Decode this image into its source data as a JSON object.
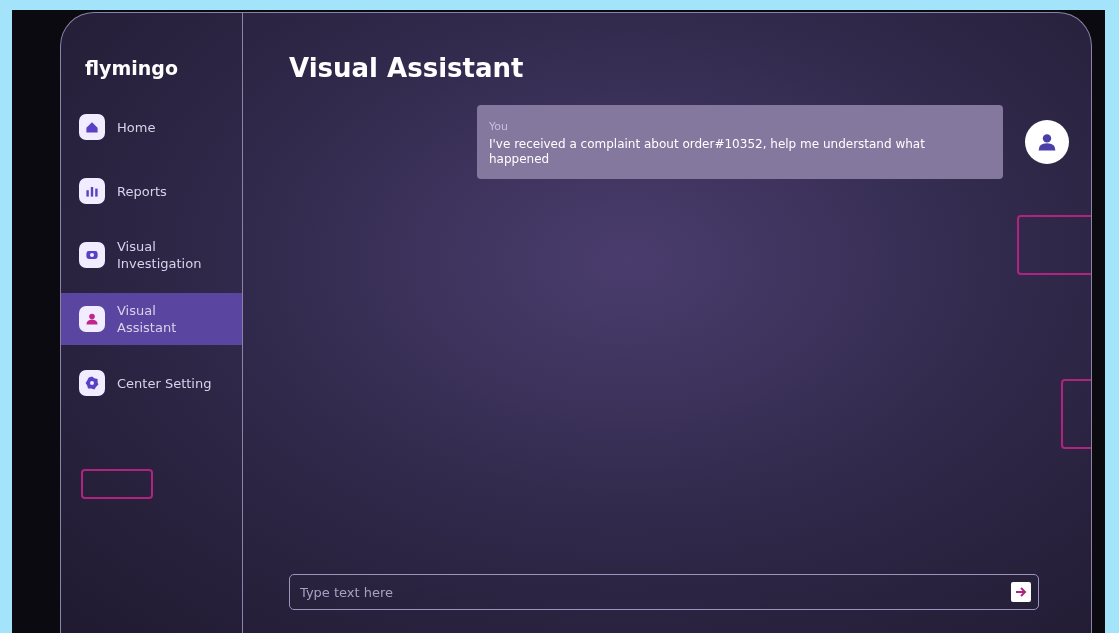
{
  "logo": "flymingo",
  "sidebar": {
    "items": [
      {
        "label": "Home",
        "selected": false
      },
      {
        "label": "Reports",
        "selected": false
      },
      {
        "label": "Visual Investigation",
        "selected": false
      },
      {
        "label": "Visual Assistant",
        "selected": true
      },
      {
        "label": "Center Setting",
        "selected": false
      }
    ]
  },
  "title": "Visual Assistant",
  "messages": [
    {
      "sender": "You",
      "text": "I've received a complaint about order#10352, help me understand what happened"
    }
  ],
  "composer": {
    "placeholder": "Type text here"
  }
}
